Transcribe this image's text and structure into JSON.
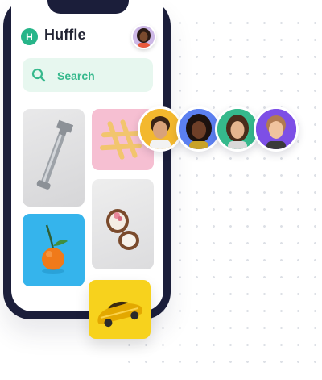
{
  "app": {
    "logo_letter": "H",
    "title": "Huffle"
  },
  "search": {
    "label": "Search"
  },
  "colors": {
    "brand_green": "#27b589",
    "phone_frame": "#1b1e3a",
    "search_bg": "#e7f7ef",
    "search_text": "#37b98d"
  },
  "gallery": [
    {
      "name": "wrench-photo",
      "bg": "#dcdcde"
    },
    {
      "name": "hashtag-photo",
      "bg": "#f6bfd2"
    },
    {
      "name": "coconut-photo",
      "bg": "#e6e6e8"
    },
    {
      "name": "tangerine-photo",
      "bg": "#35b4ec"
    },
    {
      "name": "toy-car-photo",
      "bg": "#f7d21d"
    }
  ],
  "avatars": [
    {
      "name": "avatar-1",
      "bg": "#f3b82e"
    },
    {
      "name": "avatar-2",
      "bg": "#5b7ff0"
    },
    {
      "name": "avatar-3",
      "bg": "#35b98c"
    },
    {
      "name": "avatar-4",
      "bg": "#7d4fe6"
    }
  ]
}
